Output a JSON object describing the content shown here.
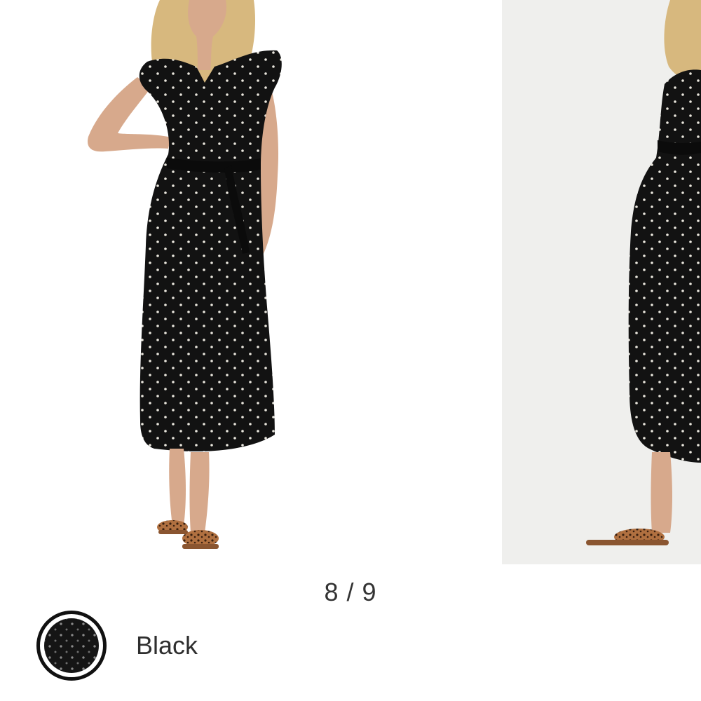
{
  "carousel": {
    "current_image": "product-photo-model-front",
    "next_image": "product-photo-model-side",
    "pager_text": "8 / 9"
  },
  "product": {
    "color_label": "Black",
    "dress_color": "#121212",
    "dot_color": "#e9e6dd",
    "skin_color": "#d7a98c",
    "hair_color": "#d7b87e",
    "sandal_color": "#b07040"
  }
}
